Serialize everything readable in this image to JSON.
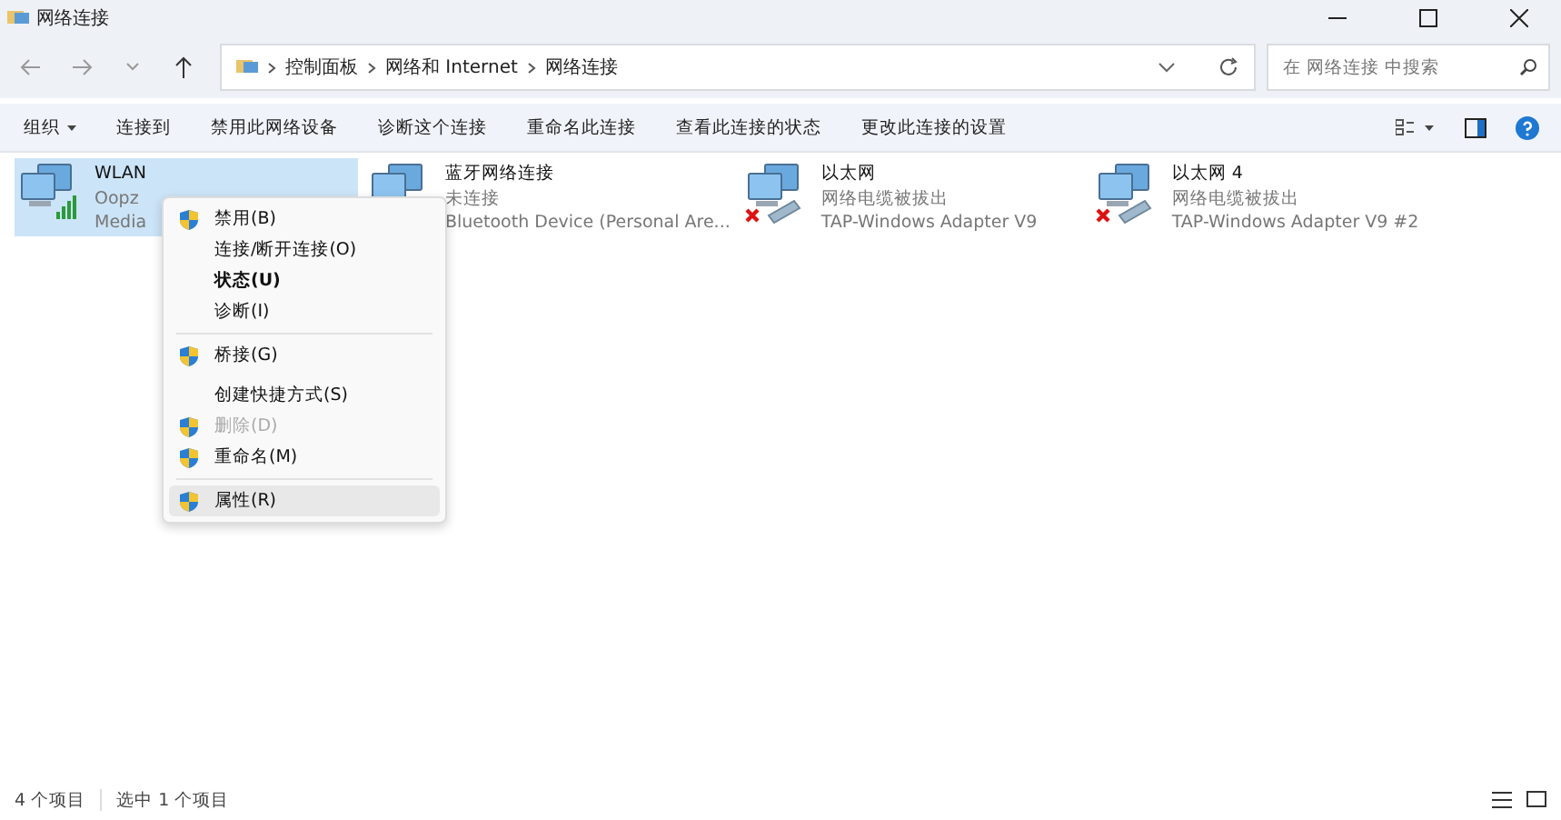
{
  "window": {
    "title": "网络连接"
  },
  "address": {
    "crumbs": [
      "控制面板",
      "网络和 Internet",
      "网络连接"
    ]
  },
  "search": {
    "placeholder": "在 网络连接 中搜索"
  },
  "toolbar": {
    "items": [
      {
        "label": "组织",
        "dropdown": true
      },
      {
        "label": "连接到",
        "dropdown": false
      },
      {
        "label": "禁用此网络设备",
        "dropdown": false
      },
      {
        "label": "诊断这个连接",
        "dropdown": false
      },
      {
        "label": "重命名此连接",
        "dropdown": false
      },
      {
        "label": "查看此连接的状态",
        "dropdown": false
      },
      {
        "label": "更改此连接的设置",
        "dropdown": false
      }
    ]
  },
  "connections": [
    {
      "name": "WLAN",
      "status": "Oopz",
      "device": "Media",
      "kind": "wifi",
      "selected": true
    },
    {
      "name": "蓝牙网络连接",
      "status": "未连接",
      "device": "Bluetooth Device (Personal Are...",
      "kind": "bluetooth",
      "selected": false
    },
    {
      "name": "以太网",
      "status": "网络电缆被拔出",
      "device": "TAP-Windows Adapter V9",
      "kind": "unplugged",
      "selected": false
    },
    {
      "name": "以太网 4",
      "status": "网络电缆被拔出",
      "device": "TAP-Windows Adapter V9 #2",
      "kind": "unplugged",
      "selected": false
    }
  ],
  "context_menu": {
    "items": [
      {
        "kind": "item",
        "label": "禁用(B)",
        "shield": true,
        "bold": false,
        "disabled": false,
        "selected": false
      },
      {
        "kind": "item",
        "label": "连接/断开连接(O)",
        "shield": false,
        "bold": false,
        "disabled": false,
        "selected": false
      },
      {
        "kind": "item",
        "label": "状态(U)",
        "shield": false,
        "bold": true,
        "disabled": false,
        "selected": false
      },
      {
        "kind": "item",
        "label": "诊断(I)",
        "shield": false,
        "bold": false,
        "disabled": false,
        "selected": false
      },
      {
        "kind": "separator"
      },
      {
        "kind": "item",
        "label": "桥接(G)",
        "shield": true,
        "bold": false,
        "disabled": false,
        "selected": false
      },
      {
        "kind": "gap"
      },
      {
        "kind": "item",
        "label": "创建快捷方式(S)",
        "shield": false,
        "bold": false,
        "disabled": false,
        "selected": false
      },
      {
        "kind": "item",
        "label": "删除(D)",
        "shield": true,
        "bold": false,
        "disabled": true,
        "selected": false
      },
      {
        "kind": "item",
        "label": "重命名(M)",
        "shield": true,
        "bold": false,
        "disabled": false,
        "selected": false
      },
      {
        "kind": "separator"
      },
      {
        "kind": "item",
        "label": "属性(R)",
        "shield": true,
        "bold": false,
        "disabled": false,
        "selected": true
      }
    ]
  },
  "status_bar": {
    "count": "4 个项目",
    "selection": "选中 1 个项目"
  }
}
